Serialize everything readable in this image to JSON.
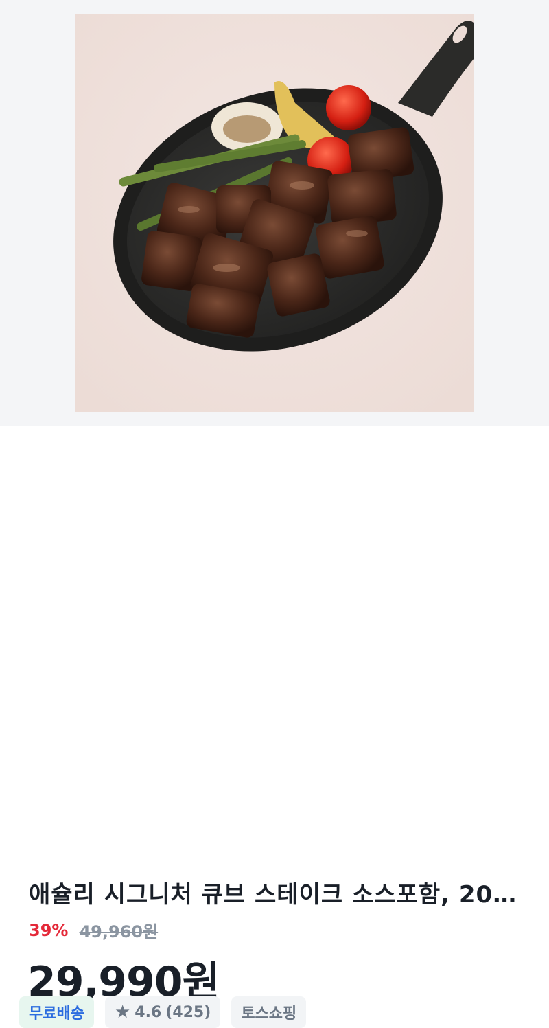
{
  "product": {
    "title": "애슐리 시그니처 큐브 스테이크 소스포함, 20…",
    "discount": "39%",
    "original_price": "49,960원",
    "price": "29,990원"
  },
  "badges": {
    "shipping": "무료배송",
    "rating_icon": "★",
    "rating": "4.6",
    "review_count": "(425)",
    "store": "토스쇼핑"
  },
  "colors": {
    "discount": "#e42939",
    "free_shipping_text": "#2b6cdf",
    "free_shipping_bg": "#e7f6ef"
  }
}
